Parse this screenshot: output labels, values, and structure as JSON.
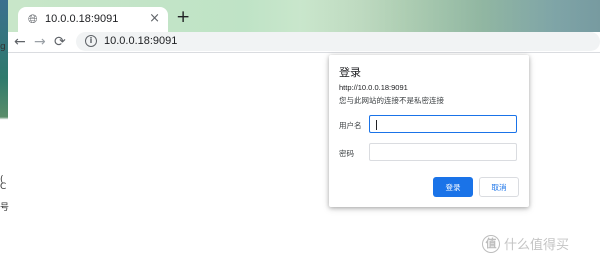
{
  "browser": {
    "tab": {
      "title": "10.0.0.18:9091",
      "icon": "globe-icon",
      "close": "×"
    },
    "new_tab": "+",
    "nav": {
      "back": "←",
      "forward": "→",
      "reload": "⟳"
    },
    "omnibox": {
      "url": "10.0.0.18:9091",
      "icon": "info-icon"
    }
  },
  "desktop_edge": {
    "g1": "g",
    "g2": "(",
    "g3": "C",
    "g4": "号"
  },
  "dialog": {
    "title": "登录",
    "url": "http://10.0.0.18:9091",
    "warning": "您与此网站的连接不是私密连接",
    "username_label": "用户名",
    "password_label": "密码",
    "username_value": "",
    "password_value": "",
    "ok_label": "登录",
    "cancel_label": "取消",
    "accent": "#1a73e8"
  },
  "watermark": {
    "logo": "值",
    "text": "什么值得买"
  }
}
